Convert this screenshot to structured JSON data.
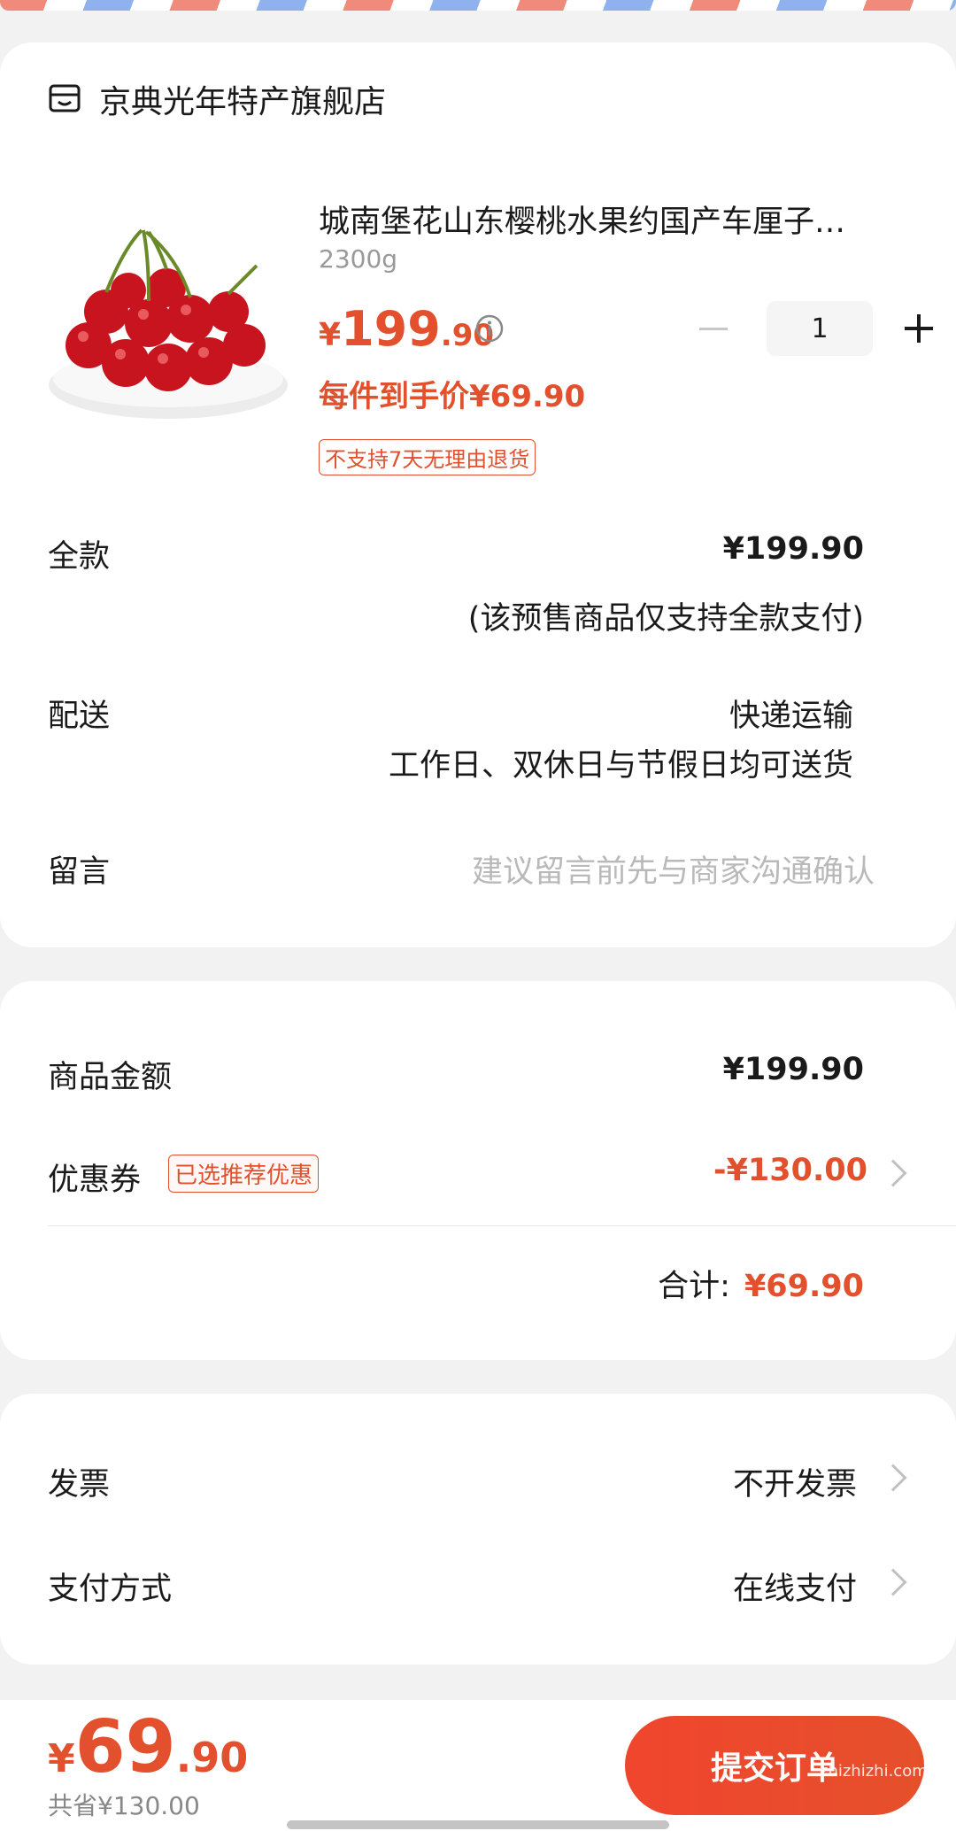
{
  "store": {
    "name": "京典光年特产旗舰店",
    "icon": "store-icon"
  },
  "product": {
    "title": "城南堡花山东樱桃水果约国产车厘子…",
    "spec": "2300g",
    "price_symbol": "¥",
    "price_int": "199",
    "price_dec": ".90",
    "unit_price": "每件到手价¥69.90",
    "quantity": "1",
    "return_tag": "不支持7天无理由退货"
  },
  "payment_mode": {
    "label": "全款",
    "value": "¥199.90",
    "note": "(该预售商品仅支持全款支付)"
  },
  "delivery": {
    "label": "配送",
    "method": "快递运输",
    "schedule": "工作日、双休日与节假日均可送货"
  },
  "message": {
    "label": "留言",
    "placeholder": "建议留言前先与商家沟通确认"
  },
  "amount": {
    "goods_label": "商品金额",
    "goods_value": "¥199.90",
    "coupon_label": "优惠券",
    "coupon_tag": "已选推荐优惠",
    "coupon_value": "-¥130.00",
    "total_label": "合计:",
    "total_value": "¥69.90"
  },
  "invoice": {
    "label": "发票",
    "value": "不开发票"
  },
  "pay_method": {
    "label": "支付方式",
    "value": "在线支付"
  },
  "footer": {
    "total_symbol": "¥",
    "total_int": "69",
    "total_dec": ".90",
    "saved": "共省¥130.00",
    "submit": "提交订单",
    "watermark": "zhizhizhi.com"
  },
  "colors": {
    "accent": "#e2502d",
    "background": "#f2f2f2"
  }
}
